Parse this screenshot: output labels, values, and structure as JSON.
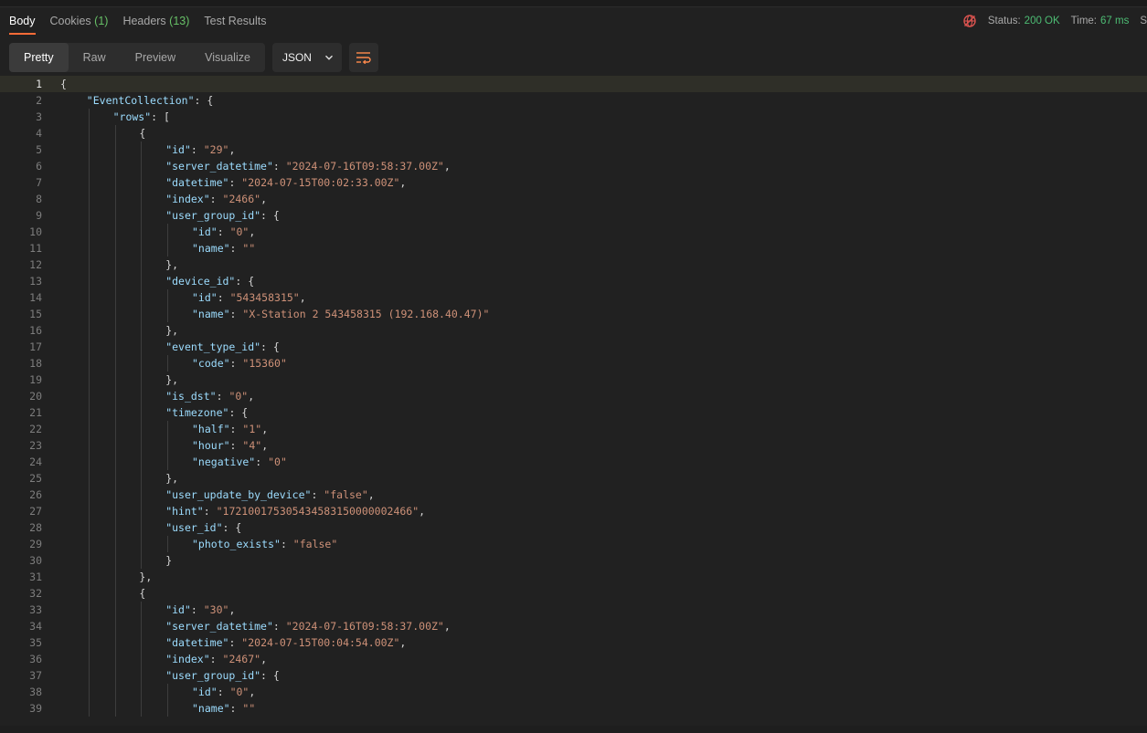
{
  "tabs": [
    {
      "label": "Body",
      "count": ""
    },
    {
      "label": "Cookies",
      "count": "(1)"
    },
    {
      "label": "Headers",
      "count": "(13)"
    },
    {
      "label": "Test Results",
      "count": ""
    }
  ],
  "status": {
    "status_label": "Status:",
    "status_value": "200 OK",
    "time_label": "Time:",
    "time_value": "67 ms",
    "truncated": "S"
  },
  "view_modes": [
    "Pretty",
    "Raw",
    "Preview",
    "Visualize"
  ],
  "format": {
    "selected": "JSON"
  },
  "colors": {
    "accent": "#ff6c37",
    "status_ok": "#4dbd74",
    "key": "#9cdcfe",
    "string": "#ce9178"
  },
  "icons": {
    "network": "globe-error-icon",
    "dropdown": "chevron-down-icon",
    "wrap": "text-wrap-icon"
  },
  "editor": {
    "cursor_line": 1,
    "lines": [
      {
        "n": "1",
        "d": 0,
        "t": [
          [
            "p",
            "{"
          ]
        ]
      },
      {
        "n": "2",
        "d": 1,
        "t": [
          [
            "k",
            "\"EventCollection\""
          ],
          [
            "p",
            ": {"
          ]
        ]
      },
      {
        "n": "3",
        "d": 2,
        "t": [
          [
            "k",
            "\"rows\""
          ],
          [
            "p",
            ": ["
          ]
        ]
      },
      {
        "n": "4",
        "d": 3,
        "t": [
          [
            "p",
            "{"
          ]
        ]
      },
      {
        "n": "5",
        "d": 4,
        "t": [
          [
            "k",
            "\"id\""
          ],
          [
            "p",
            ": "
          ],
          [
            "s",
            "\"29\""
          ],
          [
            "p",
            ","
          ]
        ]
      },
      {
        "n": "6",
        "d": 4,
        "t": [
          [
            "k",
            "\"server_datetime\""
          ],
          [
            "p",
            ": "
          ],
          [
            "s",
            "\"2024-07-16T09:58:37.00Z\""
          ],
          [
            "p",
            ","
          ]
        ]
      },
      {
        "n": "7",
        "d": 4,
        "t": [
          [
            "k",
            "\"datetime\""
          ],
          [
            "p",
            ": "
          ],
          [
            "s",
            "\"2024-07-15T00:02:33.00Z\""
          ],
          [
            "p",
            ","
          ]
        ]
      },
      {
        "n": "8",
        "d": 4,
        "t": [
          [
            "k",
            "\"index\""
          ],
          [
            "p",
            ": "
          ],
          [
            "s",
            "\"2466\""
          ],
          [
            "p",
            ","
          ]
        ]
      },
      {
        "n": "9",
        "d": 4,
        "t": [
          [
            "k",
            "\"user_group_id\""
          ],
          [
            "p",
            ": {"
          ]
        ]
      },
      {
        "n": "10",
        "d": 5,
        "t": [
          [
            "k",
            "\"id\""
          ],
          [
            "p",
            ": "
          ],
          [
            "s",
            "\"0\""
          ],
          [
            "p",
            ","
          ]
        ]
      },
      {
        "n": "11",
        "d": 5,
        "t": [
          [
            "k",
            "\"name\""
          ],
          [
            "p",
            ": "
          ],
          [
            "s",
            "\"\""
          ]
        ]
      },
      {
        "n": "12",
        "d": 4,
        "t": [
          [
            "p",
            "},"
          ]
        ]
      },
      {
        "n": "13",
        "d": 4,
        "t": [
          [
            "k",
            "\"device_id\""
          ],
          [
            "p",
            ": {"
          ]
        ]
      },
      {
        "n": "14",
        "d": 5,
        "t": [
          [
            "k",
            "\"id\""
          ],
          [
            "p",
            ": "
          ],
          [
            "s",
            "\"543458315\""
          ],
          [
            "p",
            ","
          ]
        ]
      },
      {
        "n": "15",
        "d": 5,
        "t": [
          [
            "k",
            "\"name\""
          ],
          [
            "p",
            ": "
          ],
          [
            "s",
            "\"X-Station 2 543458315 (192.168.40.47)\""
          ]
        ]
      },
      {
        "n": "16",
        "d": 4,
        "t": [
          [
            "p",
            "},"
          ]
        ]
      },
      {
        "n": "17",
        "d": 4,
        "t": [
          [
            "k",
            "\"event_type_id\""
          ],
          [
            "p",
            ": {"
          ]
        ]
      },
      {
        "n": "18",
        "d": 5,
        "t": [
          [
            "k",
            "\"code\""
          ],
          [
            "p",
            ": "
          ],
          [
            "s",
            "\"15360\""
          ]
        ]
      },
      {
        "n": "19",
        "d": 4,
        "t": [
          [
            "p",
            "},"
          ]
        ]
      },
      {
        "n": "20",
        "d": 4,
        "t": [
          [
            "k",
            "\"is_dst\""
          ],
          [
            "p",
            ": "
          ],
          [
            "s",
            "\"0\""
          ],
          [
            "p",
            ","
          ]
        ]
      },
      {
        "n": "21",
        "d": 4,
        "t": [
          [
            "k",
            "\"timezone\""
          ],
          [
            "p",
            ": {"
          ]
        ]
      },
      {
        "n": "22",
        "d": 5,
        "t": [
          [
            "k",
            "\"half\""
          ],
          [
            "p",
            ": "
          ],
          [
            "s",
            "\"1\""
          ],
          [
            "p",
            ","
          ]
        ]
      },
      {
        "n": "23",
        "d": 5,
        "t": [
          [
            "k",
            "\"hour\""
          ],
          [
            "p",
            ": "
          ],
          [
            "s",
            "\"4\""
          ],
          [
            "p",
            ","
          ]
        ]
      },
      {
        "n": "24",
        "d": 5,
        "t": [
          [
            "k",
            "\"negative\""
          ],
          [
            "p",
            ": "
          ],
          [
            "s",
            "\"0\""
          ]
        ]
      },
      {
        "n": "25",
        "d": 4,
        "t": [
          [
            "p",
            "},"
          ]
        ]
      },
      {
        "n": "26",
        "d": 4,
        "t": [
          [
            "k",
            "\"user_update_by_device\""
          ],
          [
            "p",
            ": "
          ],
          [
            "s",
            "\"false\""
          ],
          [
            "p",
            ","
          ]
        ]
      },
      {
        "n": "27",
        "d": 4,
        "t": [
          [
            "k",
            "\"hint\""
          ],
          [
            "p",
            ": "
          ],
          [
            "s",
            "\"172100175305434583150000002466\""
          ],
          [
            "p",
            ","
          ]
        ]
      },
      {
        "n": "28",
        "d": 4,
        "t": [
          [
            "k",
            "\"user_id\""
          ],
          [
            "p",
            ": {"
          ]
        ]
      },
      {
        "n": "29",
        "d": 5,
        "t": [
          [
            "k",
            "\"photo_exists\""
          ],
          [
            "p",
            ": "
          ],
          [
            "s",
            "\"false\""
          ]
        ]
      },
      {
        "n": "30",
        "d": 4,
        "t": [
          [
            "p",
            "}"
          ]
        ]
      },
      {
        "n": "31",
        "d": 3,
        "t": [
          [
            "p",
            "},"
          ]
        ]
      },
      {
        "n": "32",
        "d": 3,
        "t": [
          [
            "p",
            "{"
          ]
        ]
      },
      {
        "n": "33",
        "d": 4,
        "t": [
          [
            "k",
            "\"id\""
          ],
          [
            "p",
            ": "
          ],
          [
            "s",
            "\"30\""
          ],
          [
            "p",
            ","
          ]
        ]
      },
      {
        "n": "34",
        "d": 4,
        "t": [
          [
            "k",
            "\"server_datetime\""
          ],
          [
            "p",
            ": "
          ],
          [
            "s",
            "\"2024-07-16T09:58:37.00Z\""
          ],
          [
            "p",
            ","
          ]
        ]
      },
      {
        "n": "35",
        "d": 4,
        "t": [
          [
            "k",
            "\"datetime\""
          ],
          [
            "p",
            ": "
          ],
          [
            "s",
            "\"2024-07-15T00:04:54.00Z\""
          ],
          [
            "p",
            ","
          ]
        ]
      },
      {
        "n": "36",
        "d": 4,
        "t": [
          [
            "k",
            "\"index\""
          ],
          [
            "p",
            ": "
          ],
          [
            "s",
            "\"2467\""
          ],
          [
            "p",
            ","
          ]
        ]
      },
      {
        "n": "37",
        "d": 4,
        "t": [
          [
            "k",
            "\"user_group_id\""
          ],
          [
            "p",
            ": {"
          ]
        ]
      },
      {
        "n": "38",
        "d": 5,
        "t": [
          [
            "k",
            "\"id\""
          ],
          [
            "p",
            ": "
          ],
          [
            "s",
            "\"0\""
          ],
          [
            "p",
            ","
          ]
        ]
      },
      {
        "n": "39",
        "d": 5,
        "t": [
          [
            "k",
            "\"name\""
          ],
          [
            "p",
            ": "
          ],
          [
            "s",
            "\"\""
          ]
        ]
      }
    ]
  }
}
